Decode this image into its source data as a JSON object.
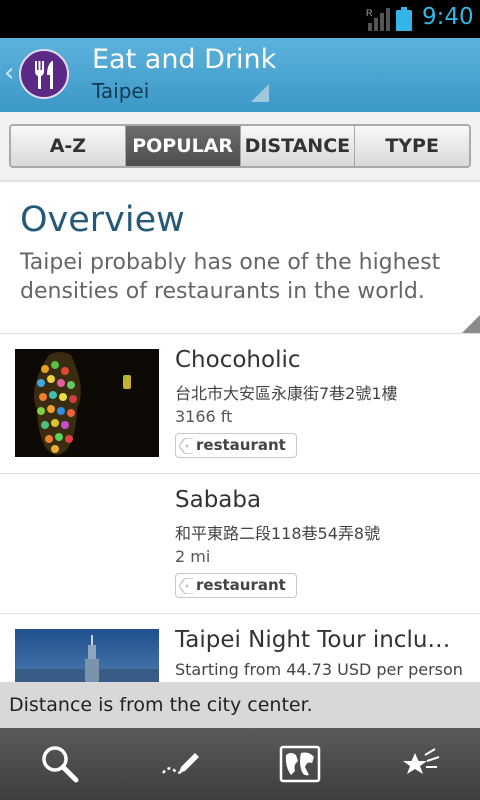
{
  "status_bar": {
    "time": "9:40",
    "network_letter": "R"
  },
  "header": {
    "title": "Eat and Drink",
    "subtitle": "Taipei"
  },
  "tabs": [
    {
      "label": "A-Z",
      "active": false
    },
    {
      "label": "POPULAR",
      "active": true
    },
    {
      "label": "DISTANCE",
      "active": false
    },
    {
      "label": "TYPE",
      "active": false
    }
  ],
  "overview": {
    "title": "Overview",
    "text": "Taipei probably has one of the highest densities of restaurants in the world."
  },
  "items": [
    {
      "title": "Chocoholic",
      "address": "台北市大安區永康街7巷2號1樓",
      "distance": "3166 ft",
      "tag": "restaurant"
    },
    {
      "title": "Sababa",
      "address": "和平東路二段118巷54弄8號",
      "distance": "2 mi",
      "tag": "restaurant"
    },
    {
      "title": "Taipei Night Tour includi…",
      "address": "Starting from 44.73 USD per person"
    }
  ],
  "info_bar": {
    "text": "Distance is from the city center."
  },
  "bottom_nav": [
    "search-icon",
    "pencil-icon",
    "map-icon",
    "favorites-icon"
  ],
  "colors": {
    "accent": "#33b5e5",
    "header": "#4aa6d4",
    "title_blue": "#245a78",
    "app_icon": "#5b2a86"
  }
}
